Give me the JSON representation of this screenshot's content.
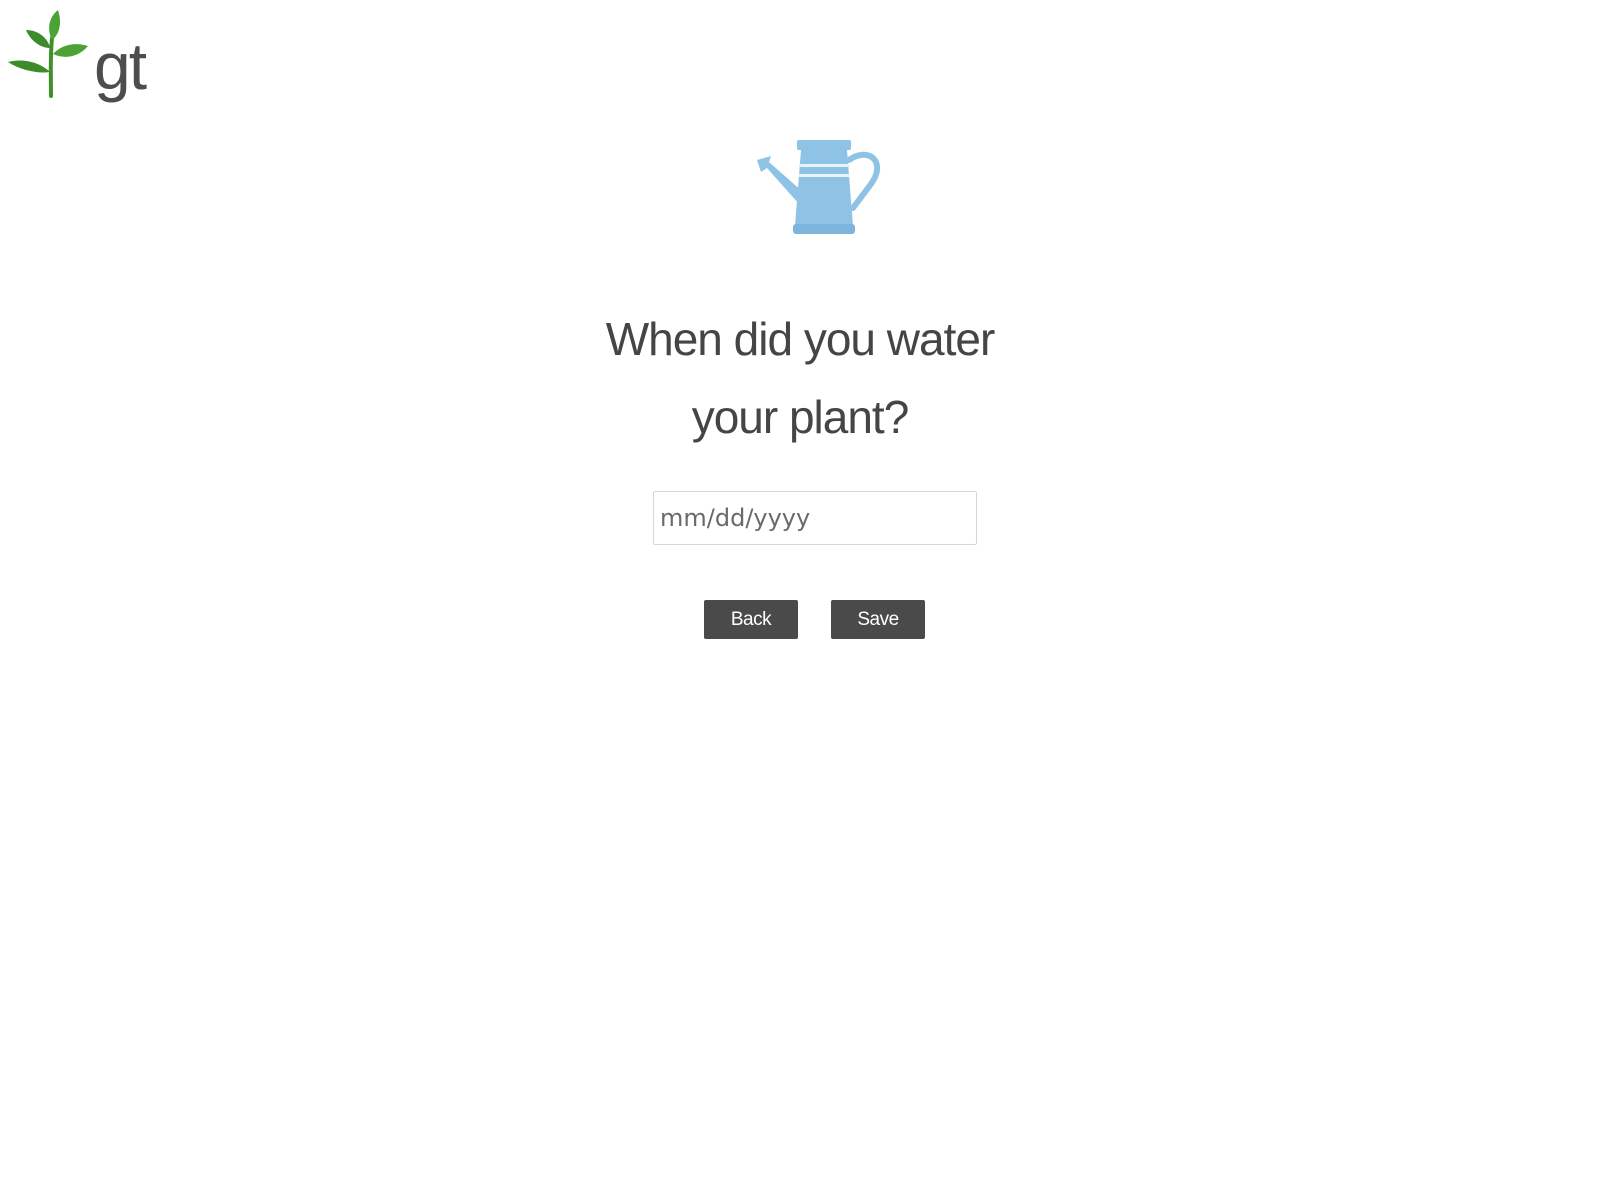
{
  "brand": {
    "logo_text": "gt",
    "leaf_color": "#3f8f2a",
    "text_color": "#4d4d4d"
  },
  "illustration": {
    "icon": "watering-can-icon",
    "color": "#8fc3e6"
  },
  "question": {
    "line1": "When did you water",
    "line2": "your plant?"
  },
  "date_field": {
    "placeholder": "mm/dd/yyyy",
    "value": ""
  },
  "buttons": {
    "back_label": "Back",
    "save_label": "Save",
    "background": "#4a4a4a"
  }
}
